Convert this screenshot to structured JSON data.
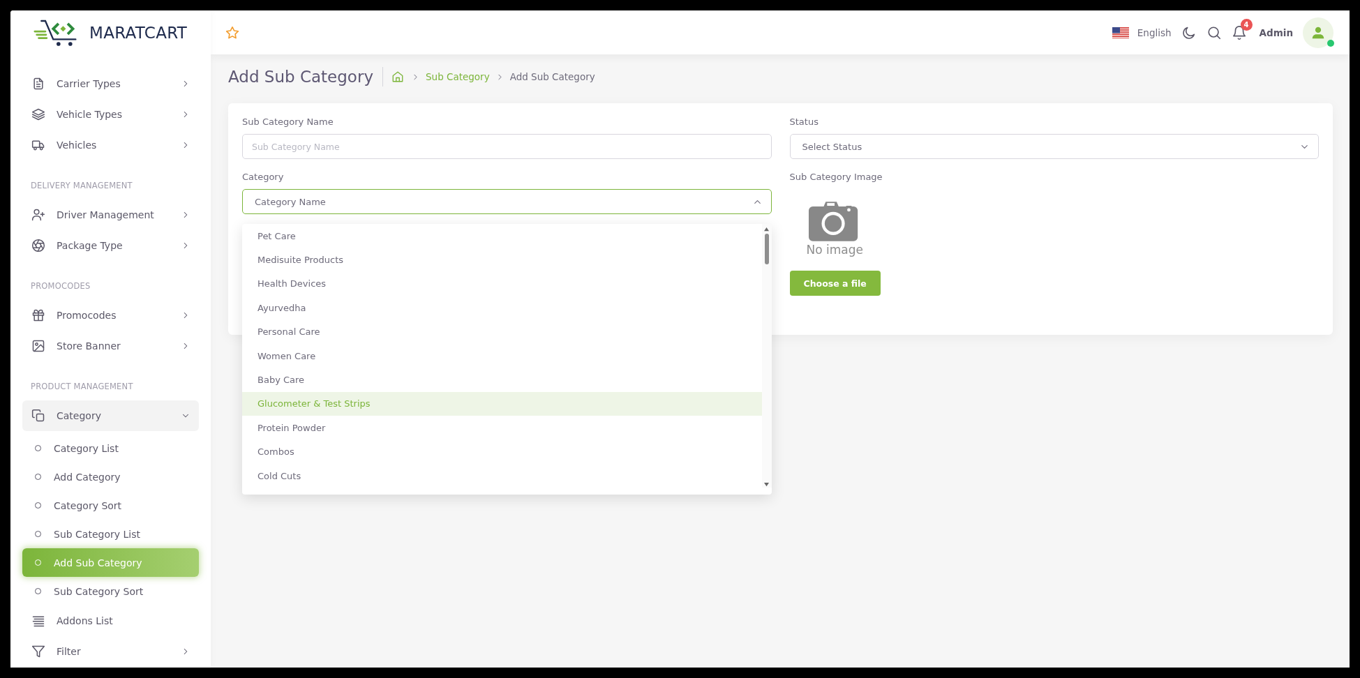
{
  "brand": {
    "name": "MARATCART"
  },
  "header": {
    "language": "English",
    "notification_count": "4",
    "user": "Admin"
  },
  "sidebar": {
    "groups": [
      {
        "items": [
          {
            "kind": "menu",
            "label": "Carrier Types",
            "expanded": false
          },
          {
            "kind": "menu",
            "label": "Vehicle Types",
            "expanded": false
          },
          {
            "kind": "menu",
            "label": "Vehicles",
            "expanded": false
          }
        ]
      },
      {
        "heading": "DELIVERY MANAGEMENT",
        "items": [
          {
            "kind": "menu",
            "label": "Driver Management",
            "expanded": false
          },
          {
            "kind": "menu",
            "label": "Package Type",
            "expanded": false
          }
        ]
      },
      {
        "heading": "PROMOCODES",
        "items": [
          {
            "kind": "menu",
            "label": "Promocodes",
            "expanded": false
          },
          {
            "kind": "menu",
            "label": "Store Banner",
            "expanded": false
          }
        ]
      },
      {
        "heading": "PRODUCT MANAGEMENT",
        "items": [
          {
            "kind": "menu",
            "label": "Category",
            "expanded": true,
            "children": [
              {
                "label": "Category List",
                "selected": false
              },
              {
                "label": "Add Category",
                "selected": false
              },
              {
                "label": "Category Sort",
                "selected": false
              },
              {
                "label": "Sub Category List",
                "selected": false
              },
              {
                "label": "Add Sub Category",
                "selected": true
              },
              {
                "label": "Sub Category Sort",
                "selected": false
              }
            ]
          },
          {
            "kind": "link",
            "label": "Addons List"
          },
          {
            "kind": "menu",
            "label": "Filter",
            "expanded": false
          }
        ]
      }
    ]
  },
  "page": {
    "title": "Add Sub Category",
    "breadcrumb": [
      {
        "kind": "link",
        "label": "Sub Category"
      },
      {
        "kind": "current",
        "label": "Add Sub Category"
      }
    ]
  },
  "form": {
    "name_field": {
      "label": "Sub Category Name",
      "placeholder": "Sub Category Name"
    },
    "category_field": {
      "label": "Category",
      "value": "Category Name",
      "expanded": true,
      "options": [
        {
          "label": "Pet Care",
          "selected": false
        },
        {
          "label": "Medisuite Products",
          "selected": false
        },
        {
          "label": "Health Devices",
          "selected": false
        },
        {
          "label": "Ayurvedha",
          "selected": false
        },
        {
          "label": "Personal Care",
          "selected": false
        },
        {
          "label": "Women Care",
          "selected": false
        },
        {
          "label": "Baby Care",
          "selected": false
        },
        {
          "label": "Glucometer & Test Strips",
          "selected": true
        },
        {
          "label": "Protein Powder",
          "selected": false
        },
        {
          "label": "Combos",
          "selected": false
        },
        {
          "label": "Cold Cuts",
          "selected": false
        }
      ]
    },
    "status_field": {
      "label": "Status",
      "value": "Select Status",
      "expanded": false
    },
    "image_field": {
      "label": "Sub Category Image",
      "preview_text": "No image",
      "button": "Choose a file"
    }
  }
}
